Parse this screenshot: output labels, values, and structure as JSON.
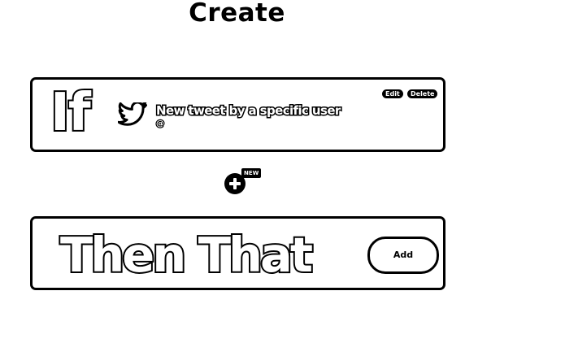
{
  "page": {
    "title": "Create"
  },
  "trigger": {
    "keyword": "If",
    "service_icon": "twitter-bird-icon",
    "title": "New tweet by a specific user",
    "field": "@",
    "edit_label": "Edit",
    "delete_label": "Delete"
  },
  "add_step": {
    "icon": "plus-circle-icon",
    "badge": "NEW"
  },
  "action": {
    "keyword": "Then That",
    "add_label": "Add"
  },
  "colors": {
    "background": "#ffffff",
    "foreground": "#000000"
  }
}
